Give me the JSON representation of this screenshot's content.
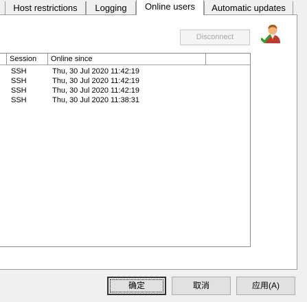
{
  "tabs": [
    {
      "label": "Host restrictions",
      "active": false
    },
    {
      "label": "Logging",
      "active": false
    },
    {
      "label": "Online users",
      "active": true
    },
    {
      "label": "Automatic updates",
      "active": false
    }
  ],
  "online_users": {
    "disconnect_label": "Disconnect",
    "columns": [
      "Session",
      "Online since"
    ],
    "rows": [
      {
        "session": "SSH",
        "online_since": "Thu, 30 Jul 2020 11:42:19"
      },
      {
        "session": "SSH",
        "online_since": "Thu, 30 Jul 2020 11:42:19"
      },
      {
        "session": "SSH",
        "online_since": "Thu, 30 Jul 2020 11:42:19"
      },
      {
        "session": "SSH",
        "online_since": "Thu, 30 Jul 2020 11:38:31"
      }
    ]
  },
  "footer": {
    "ok_label": "确定",
    "cancel_label": "取消",
    "apply_label": "应用(A)"
  },
  "colors": {
    "tab_border": "#9a9a9a",
    "disabled_text": "#a6a6a6",
    "icon_check": "#2e9e2e",
    "icon_person": "#c0392b"
  }
}
